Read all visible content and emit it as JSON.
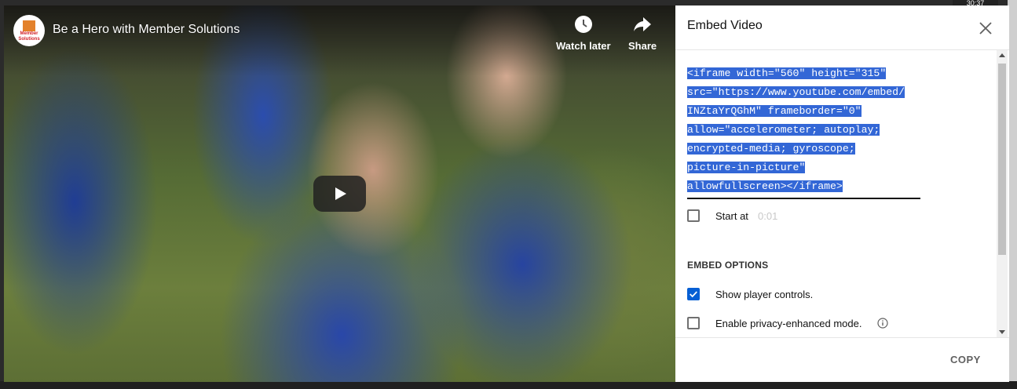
{
  "player": {
    "channel_avatar_text": "Member Solutions",
    "title": "Be a Hero with Member Solutions",
    "watch_later_label": "Watch later",
    "share_label": "Share"
  },
  "embed_panel": {
    "title": "Embed Video",
    "code_lines": [
      "<iframe width=\"560\" height=\"315\"",
      "src=\"https://www.youtube.com/embed/",
      "INZtaYrQGhM\" frameborder=\"0\"",
      "allow=\"accelerometer; autoplay;",
      "encrypted-media; gyroscope;",
      "picture-in-picture\"",
      "allowfullscreen></iframe>"
    ],
    "start_at_label": "Start at",
    "start_at_value": "0:01",
    "section_title": "EMBED OPTIONS",
    "options": [
      {
        "label": "Show player controls.",
        "checked": true
      },
      {
        "label": "Enable privacy-enhanced mode.",
        "checked": false
      }
    ],
    "copy_label": "COPY"
  },
  "colors": {
    "accent_blue": "#065fd4",
    "selection_blue": "#3367d6"
  },
  "background": {
    "timestamp_badge": "30:37"
  }
}
